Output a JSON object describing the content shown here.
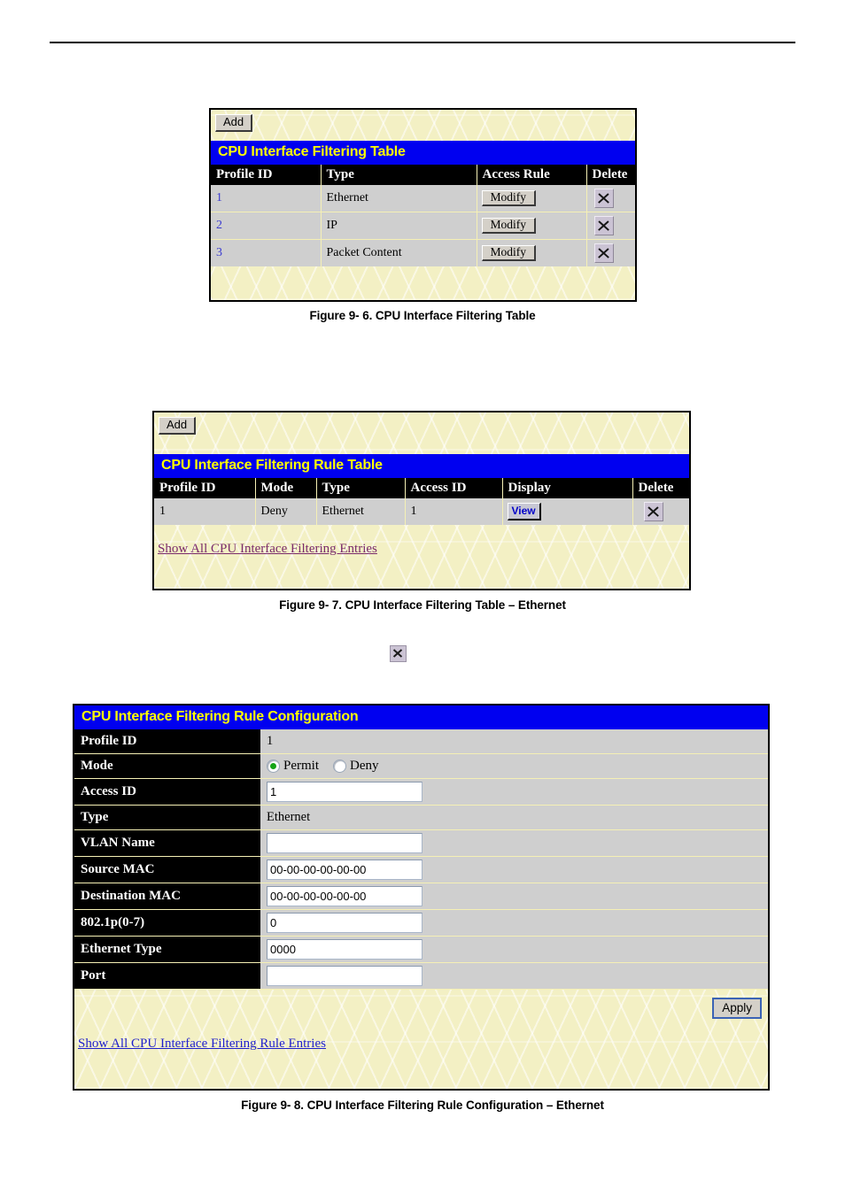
{
  "page": {
    "rule_divider": "horizontal-rule"
  },
  "figure6": {
    "add_label": "Add",
    "title": "CPU Interface Filtering Table",
    "columns": [
      "Profile ID",
      "Type",
      "Access Rule",
      "Delete"
    ],
    "rows": [
      {
        "profile_id": "1",
        "type": "Ethernet",
        "access_rule": "Modify",
        "delete": "delete-x-icon"
      },
      {
        "profile_id": "2",
        "type": "IP",
        "access_rule": "Modify",
        "delete": "delete-x-icon"
      },
      {
        "profile_id": "3",
        "type": "Packet Content",
        "access_rule": "Modify",
        "delete": "delete-x-icon"
      }
    ],
    "caption": "Figure 9- 6. CPU Interface Filtering Table"
  },
  "figure7": {
    "add_label": "Add",
    "title": "CPU Interface Filtering Rule Table",
    "columns": [
      "Profile ID",
      "Mode",
      "Type",
      "Access ID",
      "Display",
      "Delete"
    ],
    "rows": [
      {
        "profile_id": "1",
        "mode": "Deny",
        "type": "Ethernet",
        "access_id": "1",
        "display": "View",
        "delete": "delete-x-icon"
      }
    ],
    "show_all_link": "Show All CPU Interface Filtering Entries",
    "caption": "Figure 9- 7. CPU Interface Filtering Table – Ethernet"
  },
  "broken_image": {
    "name": "broken-image-placeholder-icon"
  },
  "figure8": {
    "title": "CPU Interface Filtering Rule Configuration",
    "fields": [
      {
        "label": "Profile ID",
        "kind": "text",
        "value": "1"
      },
      {
        "label": "Mode",
        "kind": "radio",
        "value": "Permit"
      },
      {
        "label": "Access ID",
        "kind": "input",
        "value": "1"
      },
      {
        "label": "Type",
        "kind": "text",
        "value": "Ethernet"
      },
      {
        "label": "VLAN Name",
        "kind": "input",
        "value": ""
      },
      {
        "label": "Source MAC",
        "kind": "input",
        "value": "00-00-00-00-00-00"
      },
      {
        "label": "Destination MAC",
        "kind": "input",
        "value": "00-00-00-00-00-00"
      },
      {
        "label": "802.1p(0-7)",
        "kind": "input",
        "value": "0"
      },
      {
        "label": "Ethernet Type",
        "kind": "input",
        "value": "0000"
      },
      {
        "label": "Port",
        "kind": "input",
        "value": ""
      }
    ],
    "mode_options": [
      "Permit",
      "Deny"
    ],
    "mode_selected": "Permit",
    "apply_label": "Apply",
    "show_all_link": "Show All CPU Interface Filtering Rule Entries",
    "caption": "Figure 9- 8. CPU Interface Filtering Rule Configuration – Ethernet"
  },
  "colors": {
    "title_bar_bg": "#0000f0",
    "title_bar_fg": "#ffff00",
    "header_row_bg": "#000000",
    "cell_bg": "#cfcfcf",
    "panel_bg": "#f3f0c4",
    "link_visited": "#7a2b6b",
    "link_unvisited": "#1f1fcc",
    "radio_on": "#16a416"
  }
}
